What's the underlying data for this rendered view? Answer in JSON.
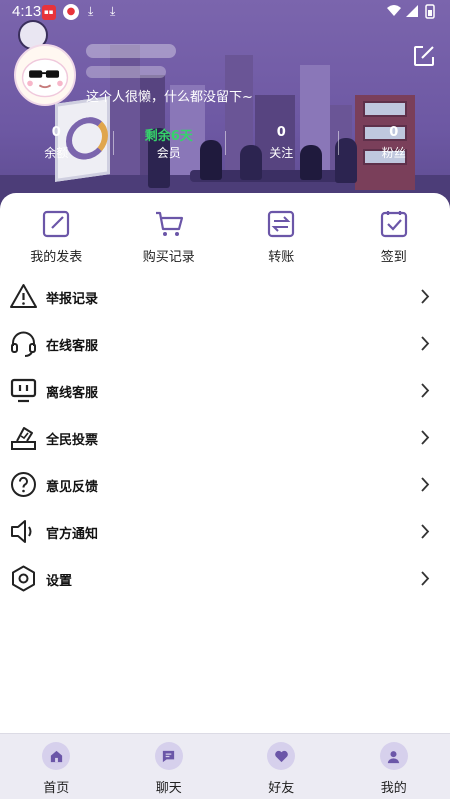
{
  "status_bar": {
    "time": "4:13",
    "notification_icons": [
      "red-app-icon",
      "headline-icon",
      "download-icon",
      "download-icon"
    ],
    "right_icons": [
      "wifi-icon",
      "signal-icon",
      "battery-icon"
    ]
  },
  "profile": {
    "signature": "这个人很懒，什么都没留下~"
  },
  "stats": [
    {
      "value": "0",
      "label": "余额"
    },
    {
      "value": "剩余6天",
      "label": "会员"
    },
    {
      "value": "0",
      "label": "关注"
    },
    {
      "value": "0",
      "label": "粉丝"
    }
  ],
  "quick_actions": [
    {
      "label": "我的发表",
      "icon": "edit-icon"
    },
    {
      "label": "购买记录",
      "icon": "cart-icon"
    },
    {
      "label": "转账",
      "icon": "transfer-icon"
    },
    {
      "label": "签到",
      "icon": "checkin-icon"
    }
  ],
  "menu": [
    {
      "label": "举报记录",
      "icon": "warning-icon"
    },
    {
      "label": "在线客服",
      "icon": "headset-icon"
    },
    {
      "label": "离线客服",
      "icon": "monitor-icon"
    },
    {
      "label": "全民投票",
      "icon": "vote-icon"
    },
    {
      "label": "意见反馈",
      "icon": "question-icon"
    },
    {
      "label": "官方通知",
      "icon": "speaker-icon"
    },
    {
      "label": "设置",
      "icon": "settings-icon"
    }
  ],
  "tabs": [
    {
      "label": "首页",
      "icon": "home-icon"
    },
    {
      "label": "聊天",
      "icon": "chat-icon"
    },
    {
      "label": "好友",
      "icon": "heart-icon"
    },
    {
      "label": "我的",
      "icon": "profile-icon"
    }
  ],
  "colors": {
    "accent": "#6b56a8",
    "member_green": "#36d36b",
    "header_purple": "#7b65ad"
  }
}
